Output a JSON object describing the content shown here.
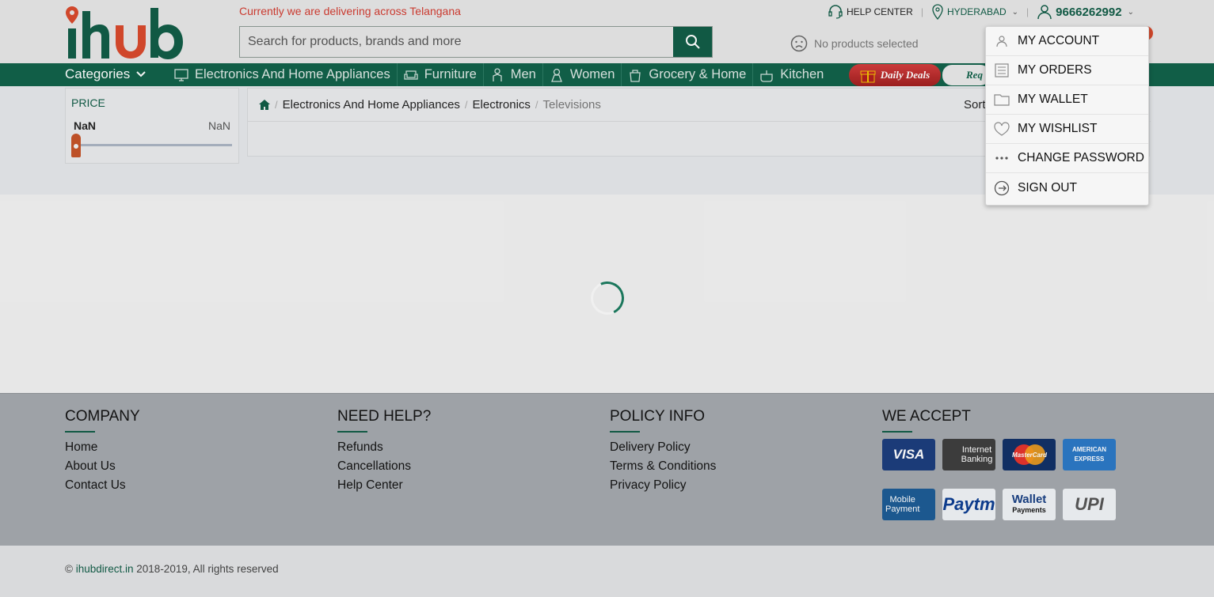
{
  "header": {
    "logo_text": "ihub",
    "delivery_note": "Currently we are delivering across Telangana",
    "search": {
      "placeholder": "Search for products, brands and more",
      "value": ""
    },
    "help_center": "HELP CENTER",
    "location": "HYDERABAD",
    "phone": "9666262992",
    "cart_status": "No products selected"
  },
  "nav": {
    "categories_label": "Categories",
    "items": [
      {
        "label": "Electronics And Home Appliances",
        "icon": "monitor-icon"
      },
      {
        "label": "Furniture",
        "icon": "sofa-icon"
      },
      {
        "label": "Men",
        "icon": "man-icon"
      },
      {
        "label": "Women",
        "icon": "woman-icon"
      },
      {
        "label": "Grocery & Home",
        "icon": "grocery-icon"
      },
      {
        "label": "Kitchen",
        "icon": "kitchen-icon"
      }
    ],
    "daily_deals": "Daily Deals",
    "request": "Req"
  },
  "filter": {
    "title": "PRICE",
    "min": "NaN",
    "max": "NaN"
  },
  "breadcrumb": {
    "items": [
      "Electronics And Home Appliances",
      "Electronics",
      "Televisions"
    ],
    "sort_label": "Sort"
  },
  "account_menu": {
    "items": [
      {
        "label": "MY ACCOUNT",
        "icon": "user-icon"
      },
      {
        "label": "MY ORDERS",
        "icon": "list-icon"
      },
      {
        "label": "MY WALLET",
        "icon": "wallet-icon"
      },
      {
        "label": "MY WISHLIST",
        "icon": "heart-icon"
      },
      {
        "label": "CHANGE PASSWORD",
        "icon": "dots-icon"
      },
      {
        "label": "SIGN OUT",
        "icon": "sign-out-icon"
      }
    ]
  },
  "footer": {
    "company": {
      "title": "COMPANY",
      "links": [
        "Home",
        "About Us",
        "Contact Us"
      ]
    },
    "help": {
      "title": "NEED HELP?",
      "links": [
        "Refunds",
        "Cancellations",
        "Help Center"
      ]
    },
    "policy": {
      "title": "POLICY INFO",
      "links": [
        "Delivery Policy",
        "Terms & Conditions",
        "Privacy Policy"
      ]
    },
    "accept": {
      "title": "WE ACCEPT"
    },
    "payments": {
      "visa": "VISA",
      "netbanking_1": "Internet",
      "netbanking_2": "Banking",
      "mastercard": "MasterCard",
      "amex": "AMERICAN EXPRESS",
      "mobile_1": "Mobile",
      "mobile_2": "Payment",
      "paytm": "Paytm",
      "wallet_1": "Wallet",
      "wallet_2": "Payments",
      "upi": "UPI"
    },
    "copyright_prefix": "©",
    "copyright_site": "ihubdirect.in",
    "copyright_suffix": "2018-2019, All rights reserved"
  }
}
